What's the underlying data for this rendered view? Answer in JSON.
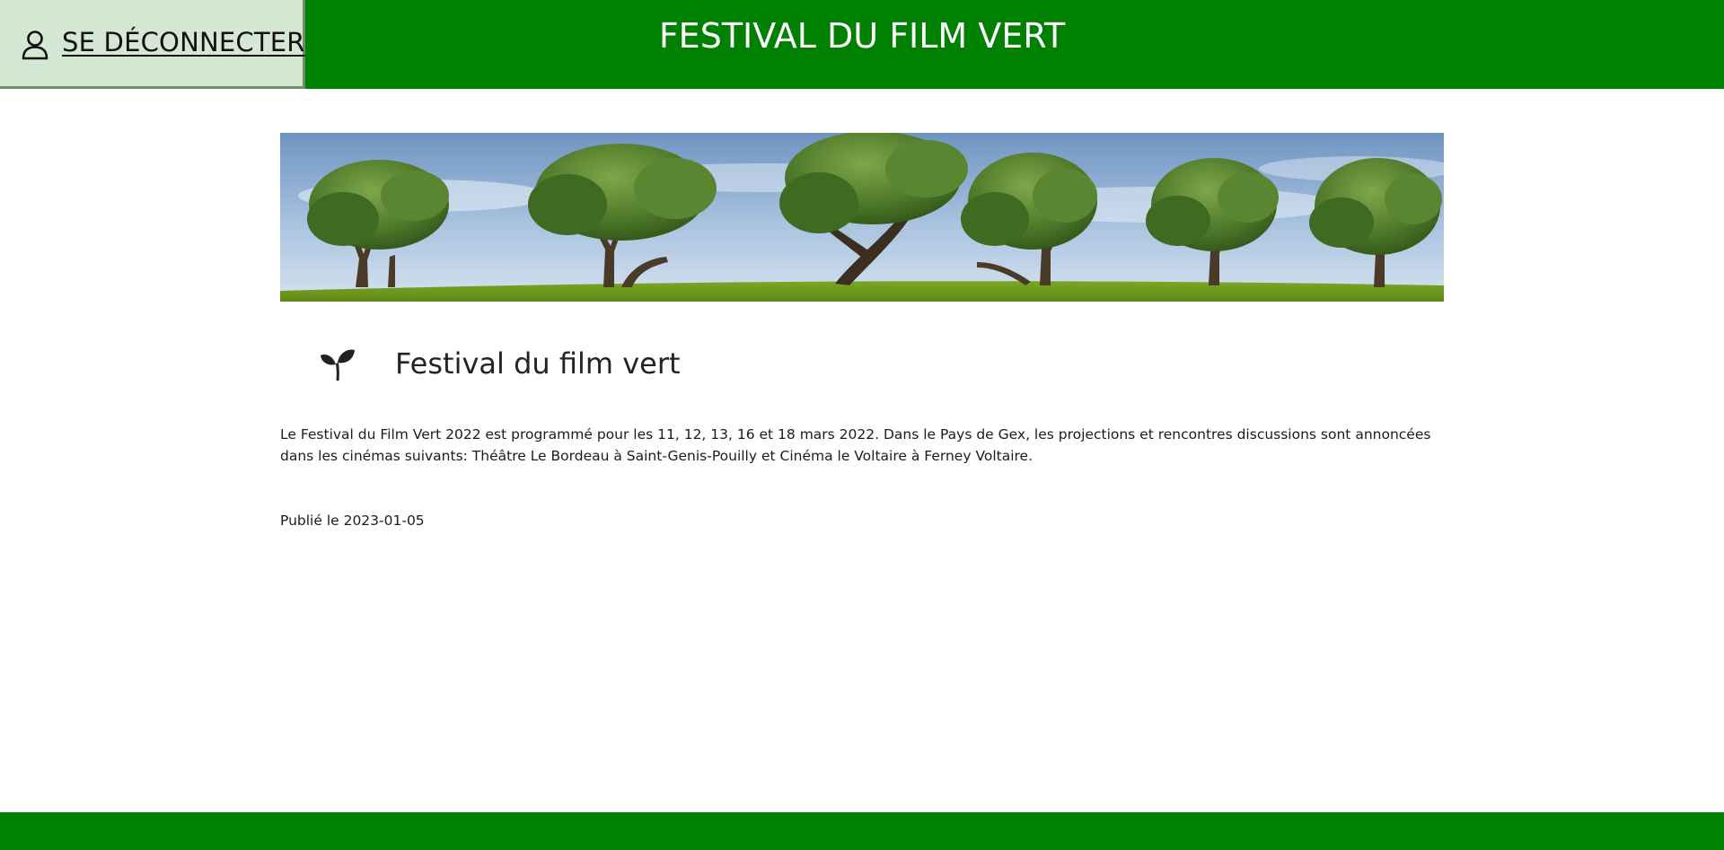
{
  "header": {
    "logout_label": "SE DÉCONNECTER",
    "title": "FESTIVAL DU FILM VERT",
    "background_color": "#008000",
    "logout_button_color": "#d5e8d4",
    "logout_icon": "user-icon"
  },
  "banner": {
    "icon": "banner-image"
  },
  "article": {
    "icon": "seedling-icon",
    "title": "Festival du film vert",
    "body": "Le Festival du Film Vert 2022 est programmé pour les 11, 12, 13, 16 et 18 mars 2022. Dans le Pays de Gex, les projections et rencontres discussions sont annoncées dans les cinémas suivants: Théâtre Le Bordeau à Saint-Genis-Pouilly et Cinéma le Voltaire à Ferney Voltaire.",
    "published": "Publié le 2023-01-05"
  },
  "footer": {
    "background_color": "#008000"
  }
}
